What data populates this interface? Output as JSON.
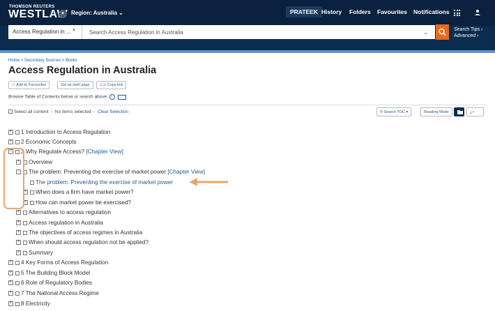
{
  "header": {
    "brand_company": "THOMSON REUTERS",
    "brand_product": "WESTLAW",
    "region": "Region: Australia",
    "nav": [
      "PRATEEK",
      "History",
      "Folders",
      "Favourites",
      "Notifications"
    ]
  },
  "search": {
    "scope": "Access Regulation in ...",
    "placeholder": "Search Access Regulation in Australia",
    "tips": "Search Tips ›",
    "advanced": "Advanced ›"
  },
  "breadcrumb": {
    "home": "Home",
    "secondary": "Secondary Sources",
    "books": "Books"
  },
  "page_title": "Access Regulation in Australia",
  "actions": {
    "favourites": "Add to Favourites",
    "start_page": "Set as start page",
    "copy_link": "Copy link"
  },
  "browse_text": "Browse Table of Contents below or search above.",
  "selection": {
    "select_all": "Select all content",
    "none_selected": "No items selected",
    "clear": "Clear Selection"
  },
  "tools": {
    "search_toc": "Search TOC",
    "reading_mode": "Reading Mode"
  },
  "toc": [
    {
      "label": "1 Introduction to Access Regulation",
      "expander": "+",
      "link": ""
    },
    {
      "label": "2 Economic Concepts",
      "expander": "+",
      "link": ""
    },
    {
      "label": "3 Why Regulate Access?",
      "expander": "−",
      "link": "[Chapter View]"
    },
    {
      "label": "Overview",
      "expander": "+",
      "link": ""
    },
    {
      "label": "The problem: Preventing the exercise of market power",
      "expander": "−",
      "link": "[Chapter View]"
    },
    {
      "label": "The problem: Preventing the exercise of market power",
      "expander": "",
      "link": ""
    },
    {
      "label": "When does a firm have market power?",
      "expander": "+",
      "link": ""
    },
    {
      "label": "How can market power be exercised?",
      "expander": "+",
      "link": ""
    },
    {
      "label": "Alternatives to access regulation",
      "expander": "+",
      "link": ""
    },
    {
      "label": "Access regulation in Australia",
      "expander": "+",
      "link": ""
    },
    {
      "label": "The objectives of access regimes in Australia",
      "expander": "+",
      "link": ""
    },
    {
      "label": "When should access regulation not be applied?",
      "expander": "+",
      "link": ""
    },
    {
      "label": "Summary",
      "expander": "+",
      "link": ""
    },
    {
      "label": "4 Key Forms of Access Regulation",
      "expander": "+",
      "link": ""
    },
    {
      "label": "5 The Building Block Model",
      "expander": "+",
      "link": ""
    },
    {
      "label": "6 Role of Regulatory Bodies",
      "expander": "+",
      "link": ""
    },
    {
      "label": "7 The National Access Regime",
      "expander": "+",
      "link": ""
    },
    {
      "label": "8 Electricity",
      "expander": "+",
      "link": ""
    }
  ],
  "colors": {
    "header_bg": "#0a2240",
    "accent": "#e86a1f",
    "link": "#215b9a",
    "annotation": "#e8a76a"
  }
}
